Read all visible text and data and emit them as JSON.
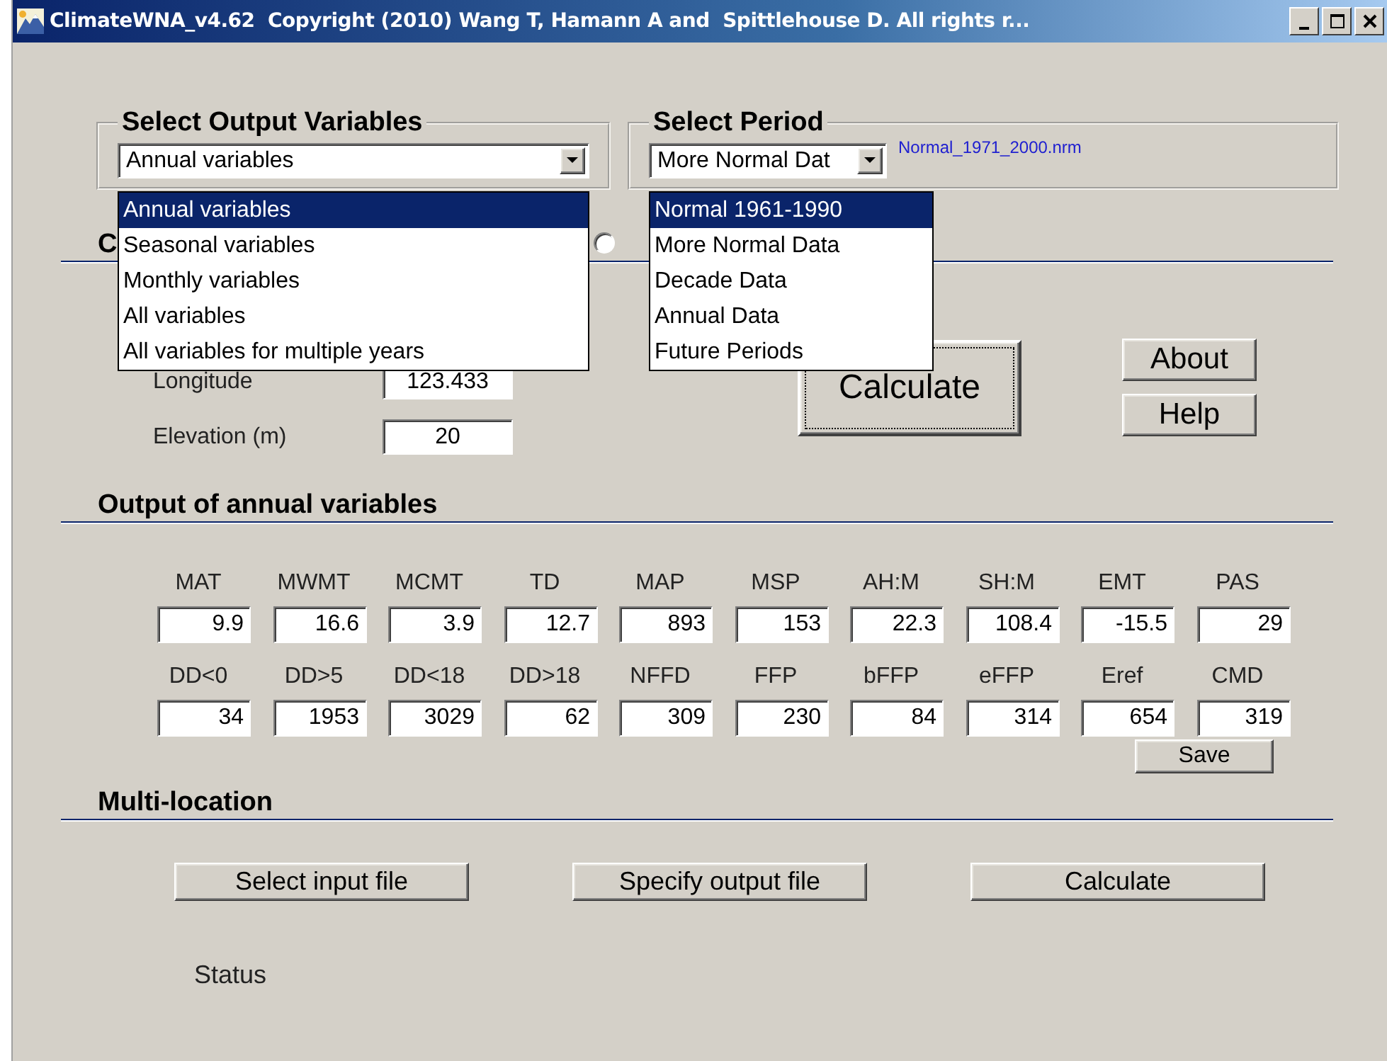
{
  "window": {
    "title": "ClimateWNA_v4.62  Copyright (2010) Wang T, Hamann A and  Spittlehouse D. All rights r..."
  },
  "output_variables": {
    "label": "Select Output Variables",
    "value": "Annual variables",
    "open": true,
    "options": [
      {
        "label": "Annual variables",
        "selected": true
      },
      {
        "label": "Seasonal variables",
        "selected": false
      },
      {
        "label": "Monthly variables",
        "selected": false
      },
      {
        "label": "All variables",
        "selected": false
      },
      {
        "label": "All variables for multiple years",
        "selected": false
      }
    ]
  },
  "period": {
    "label": "Select Period",
    "value": "More Normal Dat",
    "file": "Normal_1971_2000.nrm",
    "open": true,
    "options": [
      {
        "label": "Normal 1961-1990",
        "selected": true
      },
      {
        "label": "More Normal Data",
        "selected": false
      },
      {
        "label": "Decade Data",
        "selected": false
      },
      {
        "label": "Annual Data",
        "selected": false
      },
      {
        "label": "Future Periods",
        "selected": false
      }
    ]
  },
  "single_location": {
    "heading": "C",
    "option": {
      "selected": false
    },
    "fields": [
      {
        "label": "Longitude",
        "value": "123.433"
      },
      {
        "label": "Elevation (m)",
        "value": "20"
      }
    ],
    "calculate_button": "Calculate",
    "about_button": "About",
    "help_button": "Help"
  },
  "output": {
    "heading": "Output of annual variables",
    "variables": [
      {
        "name": "MAT",
        "value": "9.9"
      },
      {
        "name": "MWMT",
        "value": "16.6"
      },
      {
        "name": "MCMT",
        "value": "3.9"
      },
      {
        "name": "TD",
        "value": "12.7"
      },
      {
        "name": "MAP",
        "value": "893"
      },
      {
        "name": "MSP",
        "value": "153"
      },
      {
        "name": "AH:M",
        "value": "22.3"
      },
      {
        "name": "SH:M",
        "value": "108.4"
      },
      {
        "name": "EMT",
        "value": "-15.5"
      },
      {
        "name": "PAS",
        "value": "29"
      },
      {
        "name": "DD<0",
        "value": "34"
      },
      {
        "name": "DD>5",
        "value": "1953"
      },
      {
        "name": "DD<18",
        "value": "3029"
      },
      {
        "name": "DD>18",
        "value": "62"
      },
      {
        "name": "NFFD",
        "value": "309"
      },
      {
        "name": "FFP",
        "value": "230"
      },
      {
        "name": "bFFP",
        "value": "84"
      },
      {
        "name": "eFFP",
        "value": "314"
      },
      {
        "name": "Eref",
        "value": "654"
      },
      {
        "name": "CMD",
        "value": "319"
      }
    ],
    "save_button": "Save"
  },
  "multi_location": {
    "heading": "Multi-location",
    "buttons": [
      "Select input file",
      "Specify output file",
      "Calculate"
    ],
    "status": "Status"
  }
}
